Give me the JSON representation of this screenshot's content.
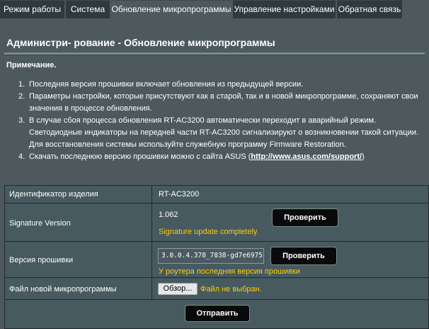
{
  "tabs": [
    {
      "label": "Режим работы",
      "active": false
    },
    {
      "label": "Система",
      "active": false
    },
    {
      "label": "Обновление микропрограммы",
      "active": true
    },
    {
      "label": "Управление настройками",
      "active": false
    },
    {
      "label": "Обратная связь",
      "active": false
    }
  ],
  "page": {
    "title": "Администри- рование - Обновление микропрограммы"
  },
  "notes": {
    "heading": "Примечание.",
    "items": [
      {
        "num": "1.",
        "text": "Последняя версия прошивки включает обновления из предыдущей версии."
      },
      {
        "num": "2.",
        "text": "Параметры настройки, которые присутствуют как в старой, так и в новой микропрограмме, сохраняют свои значения в процессе обновления."
      },
      {
        "num": "3.",
        "text": "В случае сбоя процесса обновления RT-AC3200 автоматически переходит в аварийный режим. Светодиодные индикаторы на передней части RT-AC3200 сигнализируют о возникновении такой ситуации. Для восстановления системы используйте служебную программу Firmware Restoration."
      },
      {
        "num": "4.",
        "text_before": "Скачать последнюю версию прошивки можно с сайта ASUS (",
        "link": "http://www.asus.com/support/",
        "text_after": ")"
      }
    ]
  },
  "table": {
    "product_id": {
      "label": "Идентификатор изделия",
      "value": "RT-AC3200"
    },
    "signature": {
      "label": "Signature Version",
      "value": "1.062",
      "status": "Signature update completely",
      "button": "Проверить"
    },
    "firmware": {
      "label": "Версия прошивки",
      "value": "3.0.0.4.378_7838-gd7e6975",
      "status": "У роутера последняя версия прошивки",
      "button": "Проверить"
    },
    "new_firmware": {
      "label": "Файл новой микропрограммы",
      "browse": "Обзор...",
      "no_file": "Файл не выбран."
    },
    "submit": "Отправить"
  },
  "colors": {
    "background": "#4d595d",
    "tab_inactive": "#2e3a3e",
    "status_yellow": "#ffcc00",
    "button_bg": "#0a0a0a"
  }
}
